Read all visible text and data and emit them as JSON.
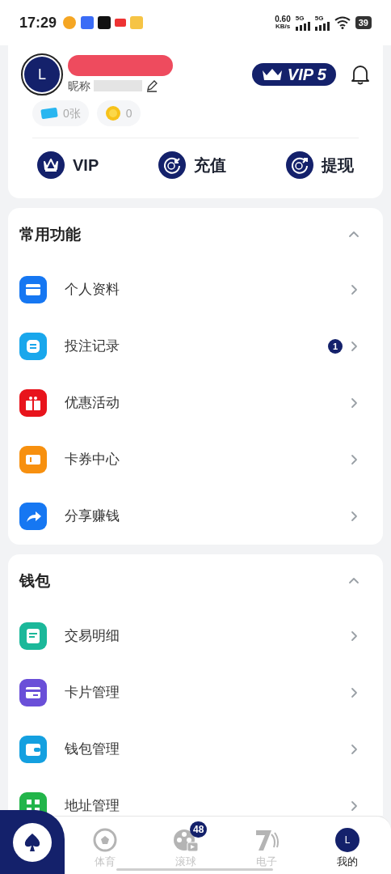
{
  "status_bar": {
    "time": "17:29",
    "net_speed": "0.60",
    "net_unit": "KB/s",
    "signals": [
      "5G",
      "5G"
    ],
    "battery": "39"
  },
  "profile": {
    "avatar_letter": "L",
    "nickname_label": "昵称",
    "vip_badge": "VIP 5",
    "tickets": "0张",
    "coins": "0"
  },
  "quick_actions": [
    {
      "kind": "crown",
      "label": "VIP"
    },
    {
      "kind": "deposit",
      "label": "充值"
    },
    {
      "kind": "withdraw",
      "label": "提现"
    }
  ],
  "sections": [
    {
      "title": "常用功能",
      "expanded": true,
      "items": [
        {
          "kind": "folder",
          "label": "个人资料",
          "color": "#1677f2"
        },
        {
          "kind": "list",
          "label": "投注记录",
          "color": "#19a7ec",
          "badge": "1"
        },
        {
          "kind": "gift",
          "label": "优惠活动",
          "color": "#e8141c"
        },
        {
          "kind": "ticket",
          "label": "卡券中心",
          "color": "#f7900f"
        },
        {
          "kind": "share",
          "label": "分享赚钱",
          "color": "#1677f2"
        }
      ]
    },
    {
      "title": "钱包",
      "expanded": true,
      "items": [
        {
          "kind": "doc",
          "label": "交易明细",
          "color": "#1bb89a"
        },
        {
          "kind": "card",
          "label": "卡片管理",
          "color": "#6a4fd8"
        },
        {
          "kind": "wallet",
          "label": "钱包管理",
          "color": "#14a0e0"
        },
        {
          "kind": "qr",
          "label": "地址管理",
          "color": "#22b54a"
        }
      ]
    }
  ],
  "bottom_nav": [
    {
      "kind": "ball",
      "label": "体育",
      "selected": false
    },
    {
      "kind": "reel",
      "label": "滚球",
      "selected": false,
      "badge": "48"
    },
    {
      "kind": "seven",
      "label": "电子",
      "selected": false
    },
    {
      "kind": "avatar",
      "label": "我的",
      "selected": true,
      "avatar_letter": "L"
    }
  ]
}
